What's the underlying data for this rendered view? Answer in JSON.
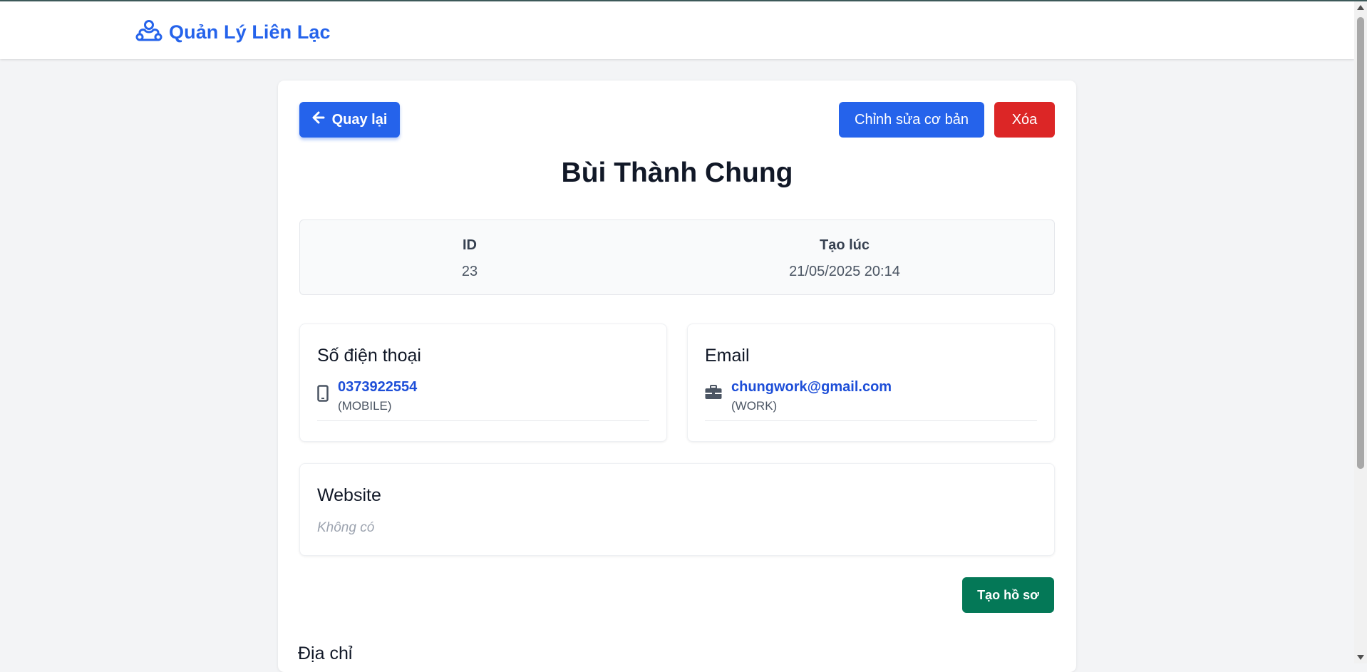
{
  "app": {
    "title": "Quản Lý Liên Lạc",
    "brand_color": "#2563eb"
  },
  "toolbar": {
    "back_label": "Quay lại",
    "edit_label": "Chỉnh sửa cơ bản",
    "delete_label": "Xóa"
  },
  "contact": {
    "name": "Bùi Thành Chung",
    "meta": {
      "id_label": "ID",
      "id_value": "23",
      "created_label": "Tạo lúc",
      "created_value": "21/05/2025 20:14"
    },
    "phone_section": {
      "title": "Số điện thoại",
      "icon": "mobile-phone-icon",
      "number": "0373922554",
      "type": "(MOBILE)"
    },
    "email_section": {
      "title": "Email",
      "icon": "briefcase-icon",
      "address": "chungwork@gmail.com",
      "type": "(WORK)"
    },
    "website_section": {
      "title": "Website",
      "empty_text": "Không có"
    },
    "create_profile_label": "Tạo hồ sơ",
    "address_title": "Địa chỉ"
  },
  "colors": {
    "primary": "#2563eb",
    "danger": "#dc2626",
    "success": "#047857"
  }
}
